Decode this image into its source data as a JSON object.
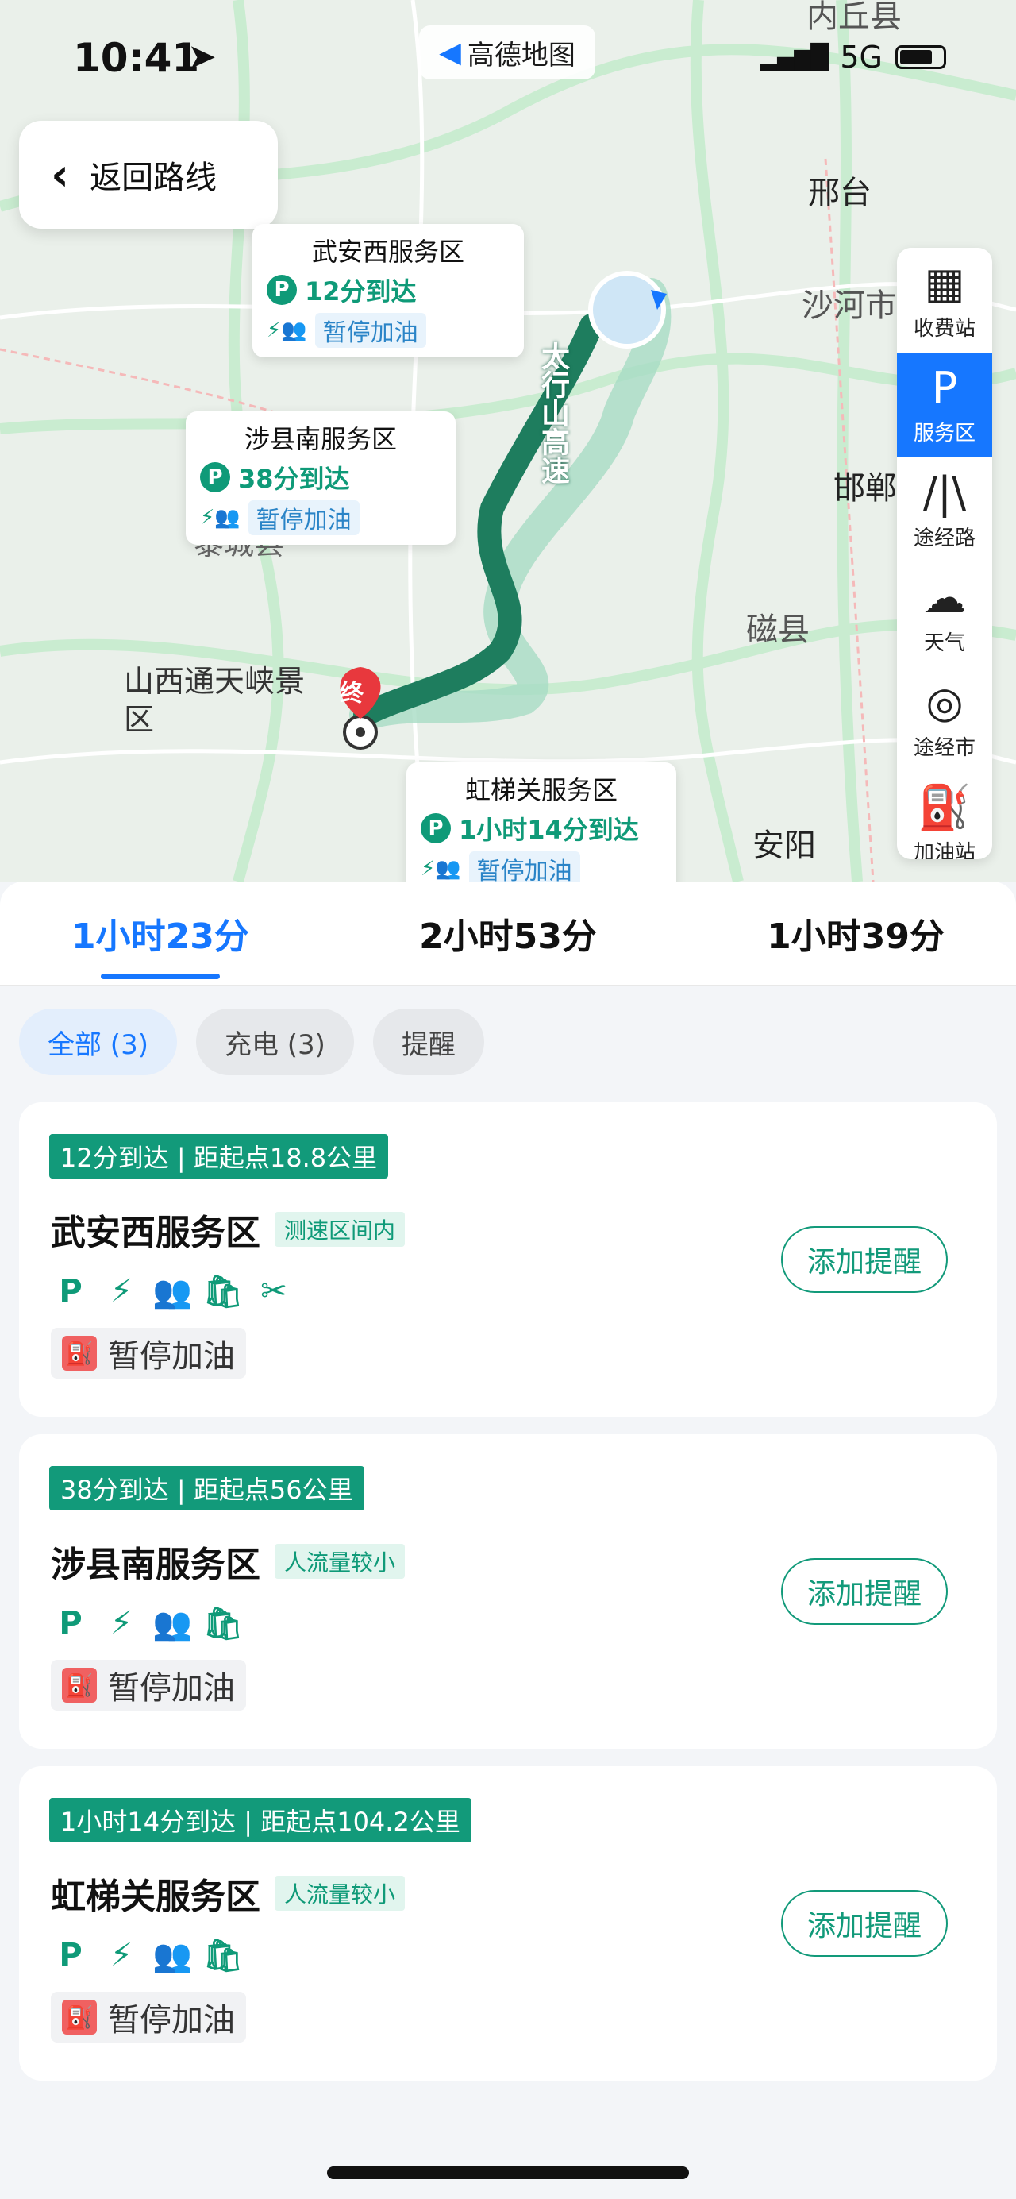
{
  "status_bar": {
    "time": "10:41",
    "app": "高德地图",
    "network": "5G"
  },
  "back_button": {
    "label": "返回路线"
  },
  "map": {
    "labels": [
      "山西通天峡景区",
      "黎城县"
    ],
    "cities": [
      "邢台",
      "沙河市",
      "邯郸",
      "磁县",
      "安阳",
      "内丘县"
    ],
    "road_name": "太行山高速",
    "end_marker": "终",
    "callouts": [
      {
        "name": "武安西服务区",
        "eta": "12分到达",
        "fuel": "暂停加油"
      },
      {
        "name": "涉县南服务区",
        "eta": "38分到达",
        "fuel": "暂停加油"
      },
      {
        "name": "虹梯关服务区",
        "eta": "1小时14分到达",
        "fuel": "暂停加油"
      }
    ],
    "route_color": "#1e7d5e"
  },
  "right_panel": [
    {
      "label": "收费站",
      "icon": "toll-icon"
    },
    {
      "label": "服务区",
      "icon": "service-area-icon"
    },
    {
      "label": "途经路",
      "icon": "road-icon"
    },
    {
      "label": "天气",
      "icon": "cloud-icon"
    },
    {
      "label": "途经市",
      "icon": "city-pin-icon"
    },
    {
      "label": "加油站",
      "icon": "fuel-pump-icon"
    }
  ],
  "route_tabs": [
    "1小时23分",
    "2小时53分",
    "1小时39分"
  ],
  "filters": [
    "全部 (3)",
    "充电 (3)",
    "提醒"
  ],
  "service_areas": [
    {
      "badge": "12分到达 | 距起点18.8公里",
      "name": "武安西服务区",
      "tag": "测速区间内",
      "fuel_status": "暂停加油",
      "button": "添加提醒",
      "facilities": [
        "parking-icon",
        "charging-icon",
        "restroom-icon",
        "shop-icon",
        "repair-icon"
      ]
    },
    {
      "badge": "38分到达 | 距起点56公里",
      "name": "涉县南服务区",
      "tag": "人流量较小",
      "fuel_status": "暂停加油",
      "button": "添加提醒",
      "facilities": [
        "parking-icon",
        "charging-icon",
        "restroom-icon",
        "shop-icon"
      ]
    },
    {
      "badge": "1小时14分到达 | 距起点104.2公里",
      "name": "虹梯关服务区",
      "tag": "人流量较小",
      "fuel_status": "暂停加油",
      "button": "添加提醒",
      "facilities": [
        "parking-icon",
        "charging-icon",
        "restroom-icon",
        "shop-icon"
      ]
    }
  ],
  "colors": {
    "accent": "#1677ff",
    "green": "#129a7a"
  }
}
